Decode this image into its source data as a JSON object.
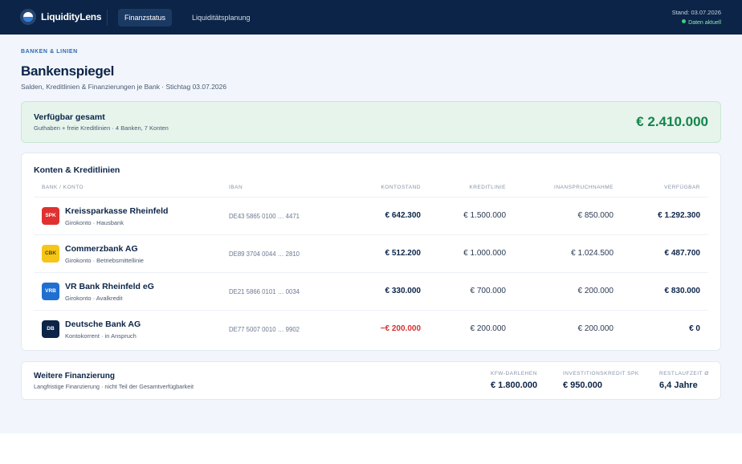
{
  "app": {
    "brand": "LiquidityLens",
    "nav": [
      {
        "label": "Finanzstatus",
        "active": true
      },
      {
        "label": "Liquiditätsplanung",
        "active": false
      }
    ],
    "stand": "Stand: 03.07.2026",
    "status": "Daten aktuell"
  },
  "page": {
    "eyebrow": "BANKEN & LINIEN",
    "title": "Bankenspiegel",
    "subtitle": "Salden, Kreditlinien & Finanzierungen je Bank · Stichtag 03.07.2026"
  },
  "available": {
    "title": "Verfügbar gesamt",
    "subtitle": "Guthaben + freie Kreditlinien · 4 Banken, 7 Konten",
    "value": "€ 2.410.000",
    "accent": "#14854a"
  },
  "accounts": {
    "title": "Konten & Kreditlinien",
    "columns": [
      "BANK / KONTO",
      "IBAN",
      "KONTOSTAND",
      "KREDITLINIE",
      "INANSPRUCHNAHME",
      "VERFÜGBAR"
    ],
    "rows": [
      {
        "abbr": "SPK",
        "color": "#e03131",
        "name": "Kreissparkasse Rheinfeld",
        "type": "Girokonto · Hausbank",
        "iban": "DE43 5865 0100 … 4471",
        "balance": "€ 642.300",
        "line": "€ 1.500.000",
        "used": "€ 850.000",
        "available": "€ 1.292.300",
        "negative": false
      },
      {
        "abbr": "CBK",
        "color": "#f5c518",
        "name": "Commerzbank AG",
        "type": "Girokonto · Betriebsmittellinie",
        "iban": "DE89 3704 0044 … 2810",
        "balance": "€ 512.200",
        "line": "€ 1.000.000",
        "used": "€ 1.024.500",
        "available": "€ 487.700",
        "negative": false
      },
      {
        "abbr": "VRB",
        "color": "#1f6fd1",
        "name": "VR Bank Rheinfeld eG",
        "type": "Girokonto · Avalkredit",
        "iban": "DE21 5866 0101 … 0034",
        "balance": "€ 330.000",
        "line": "€ 700.000",
        "used": "€ 200.000",
        "available": "€ 830.000",
        "negative": false
      },
      {
        "abbr": "DB",
        "color": "#0b2447",
        "name": "Deutsche Bank AG",
        "type": "Kontokorrent · in Anspruch",
        "iban": "DE77 5007 0010 … 9902",
        "balance": "−€ 200.000",
        "line": "€ 200.000",
        "used": "€ 200.000",
        "available": "€ 0",
        "negative": true
      }
    ]
  },
  "financing": {
    "title": "Weitere Finanzierung",
    "subtitle": "Langfristige Finanzierung · nicht Teil der Gesamtverfügbarkeit",
    "items": [
      {
        "label": "KFW-DARLEHEN",
        "value": "€ 1.800.000"
      },
      {
        "label": "INVESTITIONSKREDIT SPK",
        "value": "€ 950.000"
      },
      {
        "label": "RESTLAUFZEIT Ø",
        "value": "6,4 Jahre"
      }
    ]
  }
}
